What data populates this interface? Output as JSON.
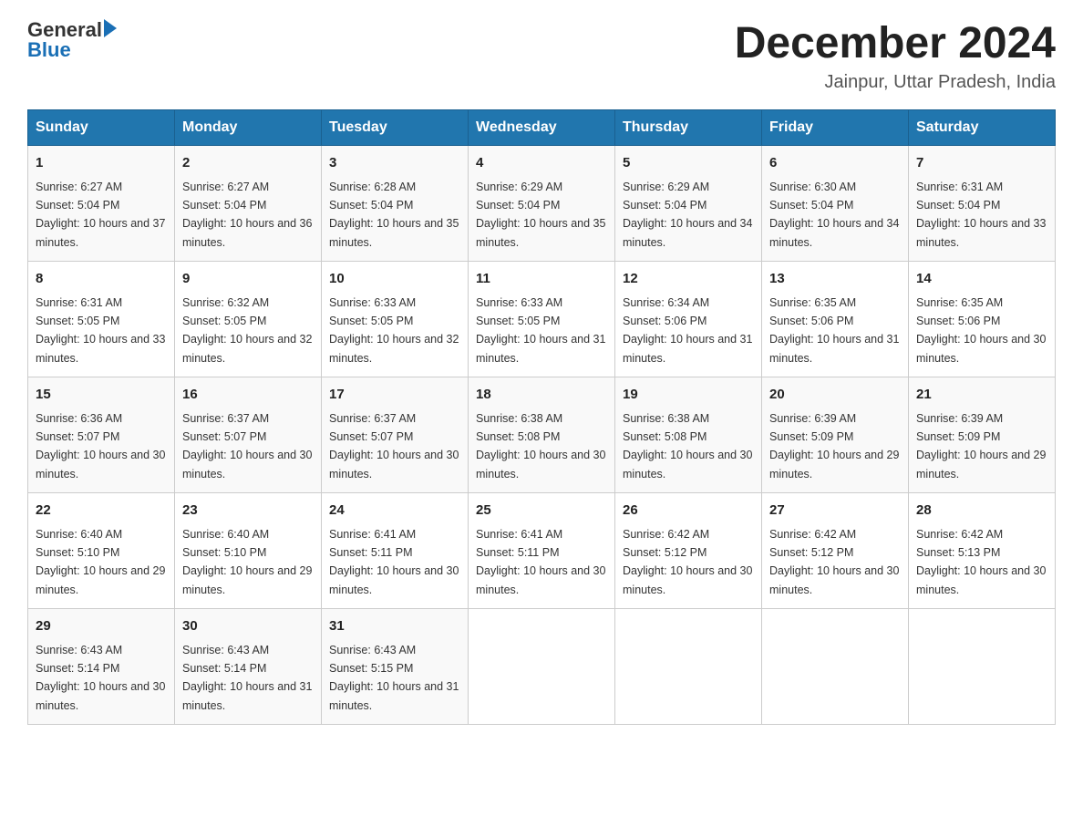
{
  "header": {
    "logo_text_general": "General",
    "logo_text_blue": "Blue",
    "month_title": "December 2024",
    "location": "Jainpur, Uttar Pradesh, India"
  },
  "days_of_week": [
    "Sunday",
    "Monday",
    "Tuesday",
    "Wednesday",
    "Thursday",
    "Friday",
    "Saturday"
  ],
  "weeks": [
    [
      {
        "day": "1",
        "sunrise": "6:27 AM",
        "sunset": "5:04 PM",
        "daylight": "10 hours and 37 minutes."
      },
      {
        "day": "2",
        "sunrise": "6:27 AM",
        "sunset": "5:04 PM",
        "daylight": "10 hours and 36 minutes."
      },
      {
        "day": "3",
        "sunrise": "6:28 AM",
        "sunset": "5:04 PM",
        "daylight": "10 hours and 35 minutes."
      },
      {
        "day": "4",
        "sunrise": "6:29 AM",
        "sunset": "5:04 PM",
        "daylight": "10 hours and 35 minutes."
      },
      {
        "day": "5",
        "sunrise": "6:29 AM",
        "sunset": "5:04 PM",
        "daylight": "10 hours and 34 minutes."
      },
      {
        "day": "6",
        "sunrise": "6:30 AM",
        "sunset": "5:04 PM",
        "daylight": "10 hours and 34 minutes."
      },
      {
        "day": "7",
        "sunrise": "6:31 AM",
        "sunset": "5:04 PM",
        "daylight": "10 hours and 33 minutes."
      }
    ],
    [
      {
        "day": "8",
        "sunrise": "6:31 AM",
        "sunset": "5:05 PM",
        "daylight": "10 hours and 33 minutes."
      },
      {
        "day": "9",
        "sunrise": "6:32 AM",
        "sunset": "5:05 PM",
        "daylight": "10 hours and 32 minutes."
      },
      {
        "day": "10",
        "sunrise": "6:33 AM",
        "sunset": "5:05 PM",
        "daylight": "10 hours and 32 minutes."
      },
      {
        "day": "11",
        "sunrise": "6:33 AM",
        "sunset": "5:05 PM",
        "daylight": "10 hours and 31 minutes."
      },
      {
        "day": "12",
        "sunrise": "6:34 AM",
        "sunset": "5:06 PM",
        "daylight": "10 hours and 31 minutes."
      },
      {
        "day": "13",
        "sunrise": "6:35 AM",
        "sunset": "5:06 PM",
        "daylight": "10 hours and 31 minutes."
      },
      {
        "day": "14",
        "sunrise": "6:35 AM",
        "sunset": "5:06 PM",
        "daylight": "10 hours and 30 minutes."
      }
    ],
    [
      {
        "day": "15",
        "sunrise": "6:36 AM",
        "sunset": "5:07 PM",
        "daylight": "10 hours and 30 minutes."
      },
      {
        "day": "16",
        "sunrise": "6:37 AM",
        "sunset": "5:07 PM",
        "daylight": "10 hours and 30 minutes."
      },
      {
        "day": "17",
        "sunrise": "6:37 AM",
        "sunset": "5:07 PM",
        "daylight": "10 hours and 30 minutes."
      },
      {
        "day": "18",
        "sunrise": "6:38 AM",
        "sunset": "5:08 PM",
        "daylight": "10 hours and 30 minutes."
      },
      {
        "day": "19",
        "sunrise": "6:38 AM",
        "sunset": "5:08 PM",
        "daylight": "10 hours and 30 minutes."
      },
      {
        "day": "20",
        "sunrise": "6:39 AM",
        "sunset": "5:09 PM",
        "daylight": "10 hours and 29 minutes."
      },
      {
        "day": "21",
        "sunrise": "6:39 AM",
        "sunset": "5:09 PM",
        "daylight": "10 hours and 29 minutes."
      }
    ],
    [
      {
        "day": "22",
        "sunrise": "6:40 AM",
        "sunset": "5:10 PM",
        "daylight": "10 hours and 29 minutes."
      },
      {
        "day": "23",
        "sunrise": "6:40 AM",
        "sunset": "5:10 PM",
        "daylight": "10 hours and 29 minutes."
      },
      {
        "day": "24",
        "sunrise": "6:41 AM",
        "sunset": "5:11 PM",
        "daylight": "10 hours and 30 minutes."
      },
      {
        "day": "25",
        "sunrise": "6:41 AM",
        "sunset": "5:11 PM",
        "daylight": "10 hours and 30 minutes."
      },
      {
        "day": "26",
        "sunrise": "6:42 AM",
        "sunset": "5:12 PM",
        "daylight": "10 hours and 30 minutes."
      },
      {
        "day": "27",
        "sunrise": "6:42 AM",
        "sunset": "5:12 PM",
        "daylight": "10 hours and 30 minutes."
      },
      {
        "day": "28",
        "sunrise": "6:42 AM",
        "sunset": "5:13 PM",
        "daylight": "10 hours and 30 minutes."
      }
    ],
    [
      {
        "day": "29",
        "sunrise": "6:43 AM",
        "sunset": "5:14 PM",
        "daylight": "10 hours and 30 minutes."
      },
      {
        "day": "30",
        "sunrise": "6:43 AM",
        "sunset": "5:14 PM",
        "daylight": "10 hours and 31 minutes."
      },
      {
        "day": "31",
        "sunrise": "6:43 AM",
        "sunset": "5:15 PM",
        "daylight": "10 hours and 31 minutes."
      },
      null,
      null,
      null,
      null
    ]
  ]
}
